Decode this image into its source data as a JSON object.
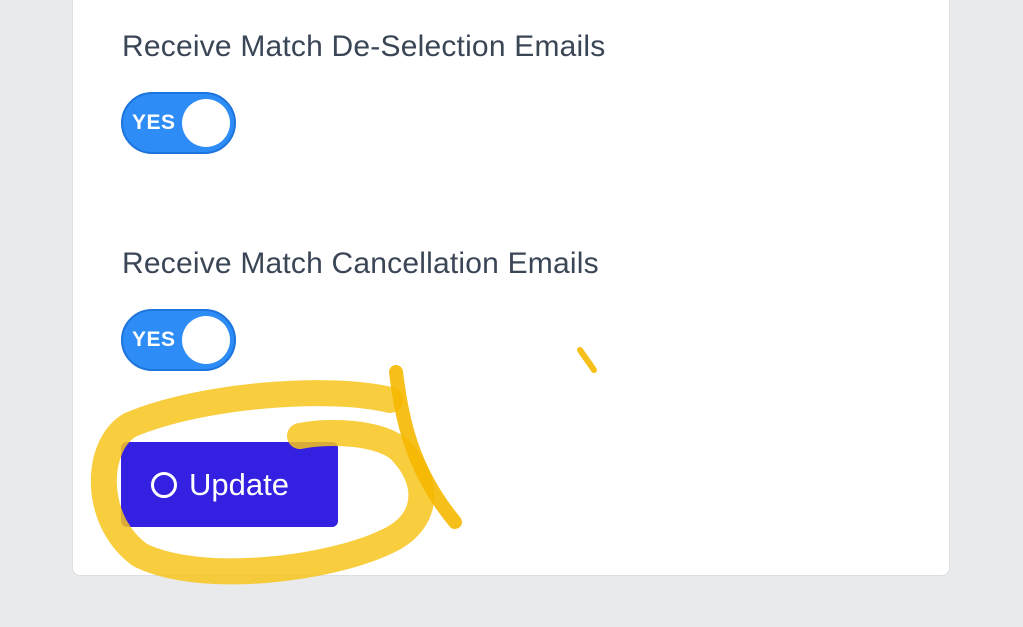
{
  "settings": {
    "deselection": {
      "label": "Receive Match De-Selection Emails",
      "toggle_text": "YES"
    },
    "cancellation": {
      "label": "Receive Match Cancellation Emails",
      "toggle_text": "YES"
    }
  },
  "actions": {
    "update_label": "Update"
  },
  "colors": {
    "toggle_on": "#2d8cf5",
    "update_button": "#3420e0",
    "highlight": "#f7c51c"
  }
}
